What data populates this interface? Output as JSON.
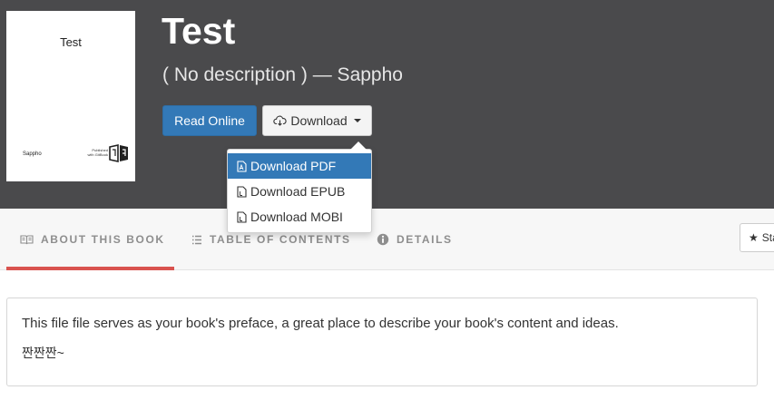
{
  "book": {
    "title": "Test",
    "subtitle": "( No description ) — Sappho"
  },
  "cover": {
    "title": "Test",
    "author": "Sappho",
    "publisher_line1": "Published",
    "publisher_line2": "with GitBook"
  },
  "actions": {
    "read_online": "Read Online",
    "download": "Download"
  },
  "download_menu": {
    "items": [
      "Download PDF",
      "Download EPUB",
      "Download MOBI"
    ],
    "active_index": 0
  },
  "tabs": {
    "about": "ABOUT THIS BOOK",
    "toc": "TABLE OF CONTENTS",
    "details": "DETAILS",
    "star": "Sta"
  },
  "content": {
    "paragraph1": "This file file serves as your book's preface, a great place to describe your book's content and ideas.",
    "paragraph2": "짠짠짠~"
  },
  "colors": {
    "hero_bg": "#4a4a4c",
    "primary": "#3379b7",
    "tab_accent": "#d9534f"
  },
  "icons": {
    "download": "cloud-download-icon",
    "file_pdf": "file-pdf-icon",
    "file": "file-icon",
    "book": "book-open-icon",
    "list": "list-icon",
    "info": "info-circle-icon",
    "star": "star-icon"
  }
}
